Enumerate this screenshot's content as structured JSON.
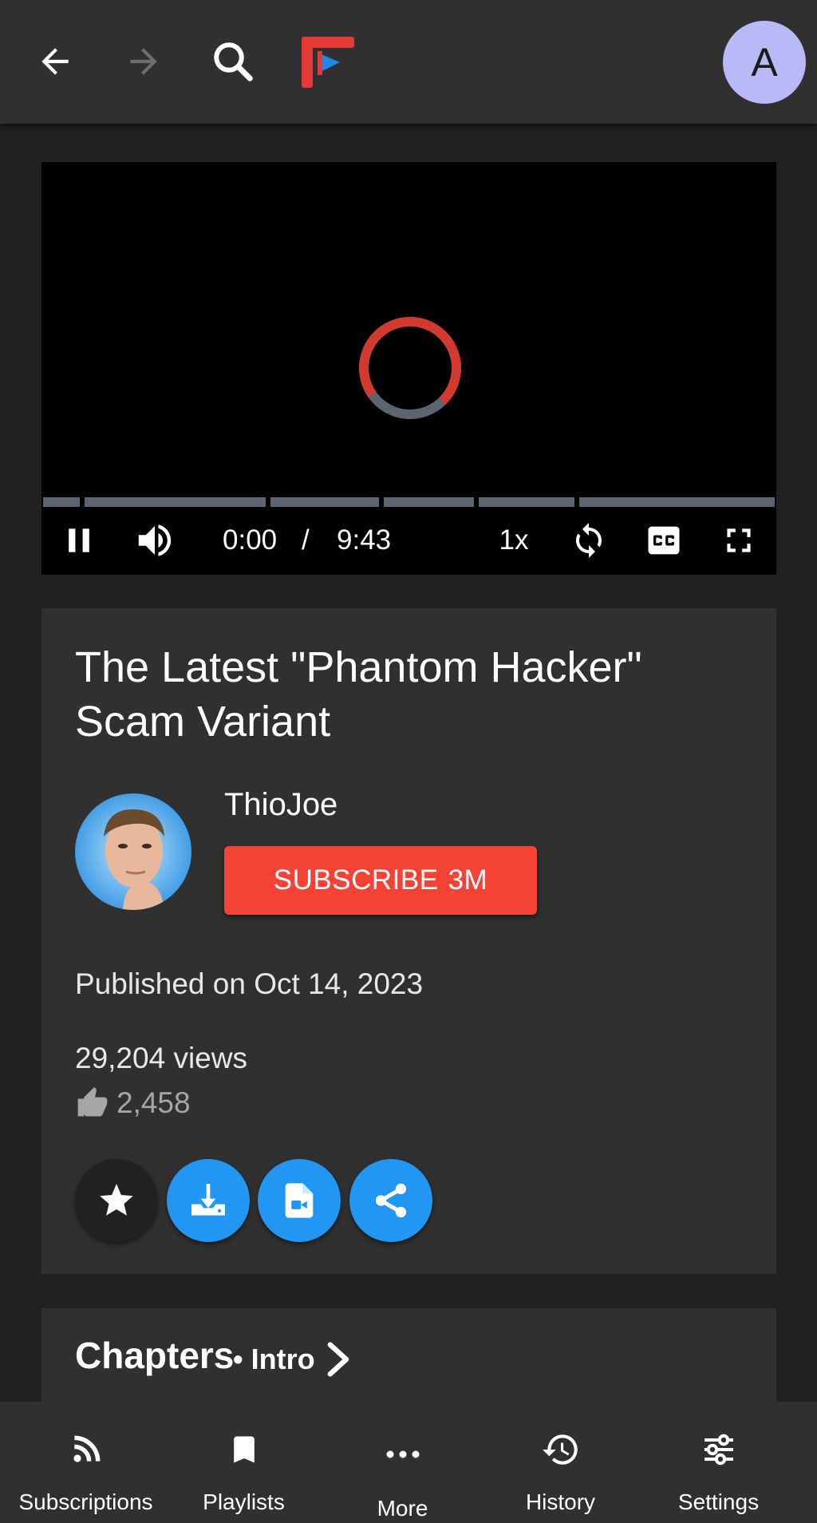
{
  "topbar": {
    "back_icon": "arrow-left-icon",
    "forward_icon": "arrow-right-icon",
    "search_icon": "search-icon",
    "logo": "app-logo",
    "avatar_letter": "A"
  },
  "player": {
    "current_time": "0:00",
    "separator": "/",
    "duration": "9:43",
    "speed": "1x",
    "progress": 0
  },
  "video": {
    "title": "The Latest \"Phantom Hacker\" Scam Variant",
    "channel_name": "ThioJoe",
    "subscribe_label": "SUBSCRIBE",
    "subscriber_count": "3M",
    "published": "Published on Oct 14, 2023",
    "views": "29,204 views",
    "likes": "2,458"
  },
  "chapters": {
    "title": "Chapters",
    "bullet": "•",
    "current": "Intro"
  },
  "bottom_nav": [
    {
      "label": "Subscriptions",
      "icon": "rss-icon"
    },
    {
      "label": "Playlists",
      "icon": "bookmark-icon"
    },
    {
      "label": "More",
      "icon": "more-dots-icon"
    },
    {
      "label": "History",
      "icon": "history-icon"
    },
    {
      "label": "Settings",
      "icon": "sliders-icon"
    }
  ],
  "colors": {
    "background": "#212121",
    "surface": "#303030",
    "subscribe": "#f44336",
    "accent_blue": "#2196f3",
    "avatar_bg": "#b7baf6"
  }
}
